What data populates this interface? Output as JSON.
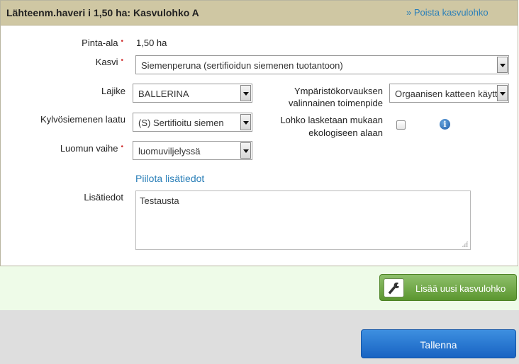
{
  "header": {
    "title": "Lähteenm.haveri i 1,50 ha: Kasvulohko A",
    "remove_link": "» Poista kasvulohko"
  },
  "form": {
    "area": {
      "label": "Pinta-ala",
      "required": "•",
      "value": "1,50 ha"
    },
    "crop": {
      "label": "Kasvi",
      "required": "•",
      "value": "Siemenperuna (sertifioidun siemenen tuotantoon)"
    },
    "variety": {
      "label": "Lajike",
      "value": "BALLERINA"
    },
    "seed_quality": {
      "label": "Kylvösiemenen laatu",
      "value": "(S) Sertifioitu siemen"
    },
    "organic_phase": {
      "label": "Luomun vaihe",
      "required": "•",
      "value": "luomuviljelyssä"
    },
    "env_measure": {
      "label_line1": "Ympäristökorvauksen",
      "label_line2": "valinnainen toimenpide",
      "value": "Orgaanisen katteen käytt"
    },
    "ecological": {
      "label_line1": "Lohko lasketaan mukaan",
      "label_line2": "ekologiseen alaan",
      "checked": false
    },
    "info_icon": "i",
    "hide_details": "Piilota lisätiedot",
    "details": {
      "label": "Lisätiedot",
      "value": "Testausta"
    }
  },
  "footer": {
    "add_button": "Lisää uusi kasvulohko",
    "save_button": "Tallenna"
  },
  "colors": {
    "header_bg": "#cfc7a3",
    "link": "#2a7fb8",
    "add_button": "#6aa53d",
    "save_button": "#1f6fce"
  }
}
